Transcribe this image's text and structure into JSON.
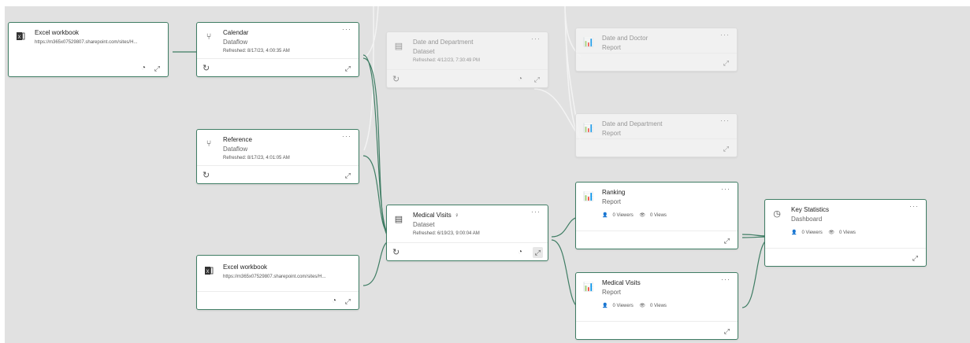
{
  "nodes": {
    "excel1": {
      "title": "Excel workbook",
      "url": "https://m365x07529807.sharepoint.com/sites/H...",
      "icon": "excel-icon"
    },
    "calendar": {
      "title": "Calendar",
      "subtitle": "Dataflow",
      "refreshed": "Refreshed: 8/17/23, 4:00:35 AM",
      "icon": "dataflow-icon"
    },
    "reference": {
      "title": "Reference",
      "subtitle": "Dataflow",
      "refreshed": "Refreshed: 8/17/23, 4:01:05 AM",
      "icon": "dataflow-icon"
    },
    "excel2": {
      "title": "Excel workbook",
      "url": "https://m365x07529807.sharepoint.com/sites/H...",
      "icon": "excel-icon"
    },
    "date_dept_dataset": {
      "title": "Date and Department",
      "subtitle": "Dataset",
      "refreshed": "Refreshed: 4/12/23, 7:30:49 PM",
      "icon": "dataset-icon"
    },
    "medical_visits_dataset": {
      "title": "Medical Visits",
      "subtitle": "Dataset",
      "refreshed": "Refreshed: 6/19/23, 9:00:04 AM",
      "icon": "dataset-icon",
      "badge_icon": "lightbulb-icon"
    },
    "date_doctor_report": {
      "title": "Date and Doctor",
      "subtitle": "Report",
      "icon": "report-icon"
    },
    "date_dept_report": {
      "title": "Date and Department",
      "subtitle": "Report",
      "icon": "report-icon"
    },
    "ranking_report": {
      "title": "Ranking",
      "subtitle": "Report",
      "viewers": "0 Viewers",
      "views": "0 Views",
      "icon": "report-icon"
    },
    "medical_visits_report": {
      "title": "Medical Visits",
      "subtitle": "Report",
      "viewers": "0 Viewers",
      "views": "0 Views",
      "icon": "report-icon"
    },
    "key_stats": {
      "title": "Key Statistics",
      "subtitle": "Dashboard",
      "viewers": "0 Viewers",
      "views": "0 Views",
      "icon": "dashboard-icon"
    }
  },
  "more_glyph": "···",
  "colors": {
    "canvas": "#e1e1e1",
    "active_border": "#3f7d64",
    "link": "#3f7d64",
    "dim_link": "#f2f2f2"
  }
}
